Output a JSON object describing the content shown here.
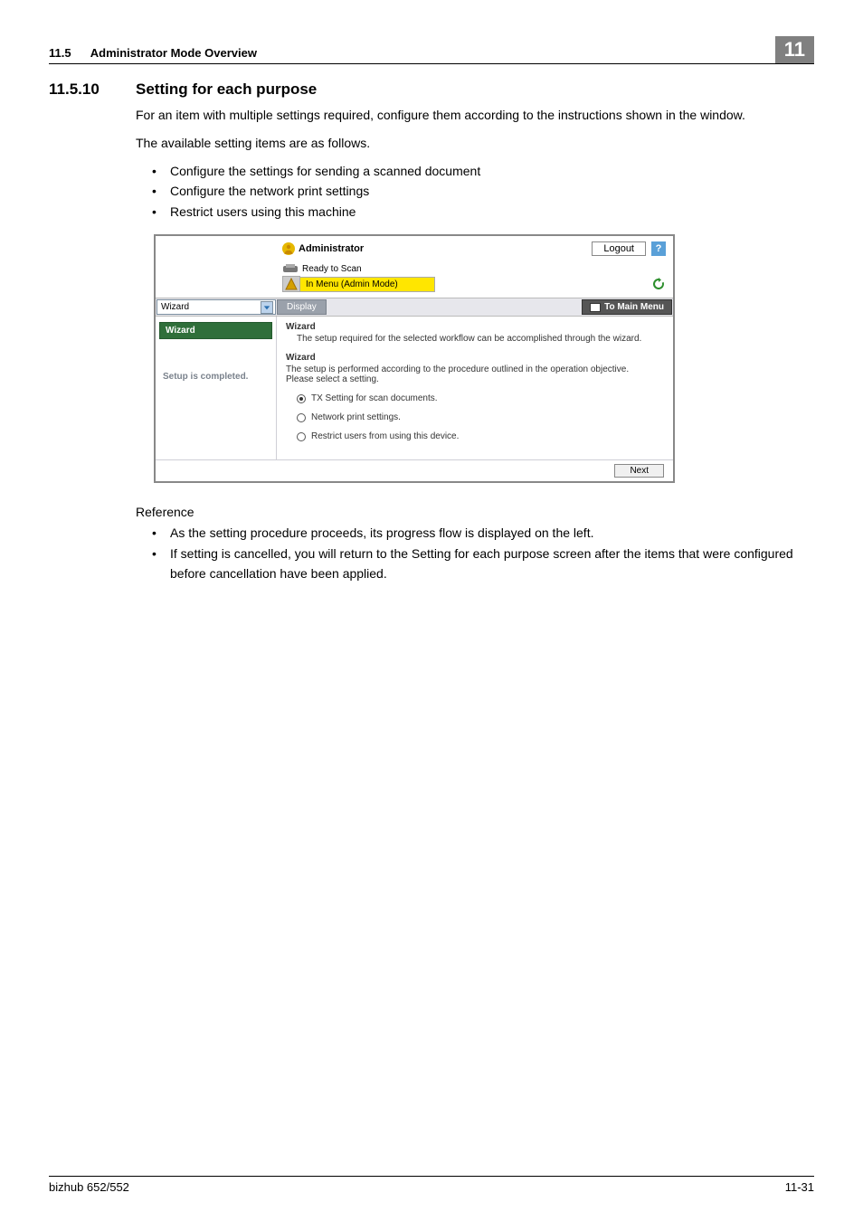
{
  "header": {
    "section_number": "11.5",
    "section_title": "Administrator Mode Overview",
    "chapter_number": "11"
  },
  "heading": {
    "number": "11.5.10",
    "title": "Setting for each purpose"
  },
  "intro": {
    "p1": "For an item with multiple settings required, configure them according to the instructions shown in the window.",
    "p2": "The available setting items are as follows.",
    "bullets": [
      "Configure the settings for sending a scanned document",
      "Configure the network print settings",
      "Restrict users using this machine"
    ]
  },
  "screenshot": {
    "admin_label": "Administrator",
    "logout": "Logout",
    "help": "?",
    "ready": "Ready to Scan",
    "mode": "In Menu (Admin Mode)",
    "select_value": "Wizard",
    "display_btn": "Display",
    "main_menu": "To Main Menu",
    "side_wizard": "Wizard",
    "side_complete": "Setup is completed.",
    "main_h1": "Wizard",
    "main_sub1": "The setup required for the selected workflow can be accomplished through the wizard.",
    "main_h2": "Wizard",
    "main_sub2a": "The setup is performed according to the procedure outlined in the operation objective.",
    "main_sub2b": "Please select a setting.",
    "radios": [
      "TX Setting for scan documents.",
      "Network print settings.",
      "Restrict users from using this device."
    ],
    "next": "Next"
  },
  "reference": {
    "label": "Reference",
    "bullets": [
      "As the setting procedure proceeds, its progress flow is displayed on the left.",
      "If setting is cancelled, you will return to the Setting for each purpose screen after the items that were configured before cancellation have been applied."
    ]
  },
  "footer": {
    "left": "bizhub 652/552",
    "right": "11-31"
  }
}
